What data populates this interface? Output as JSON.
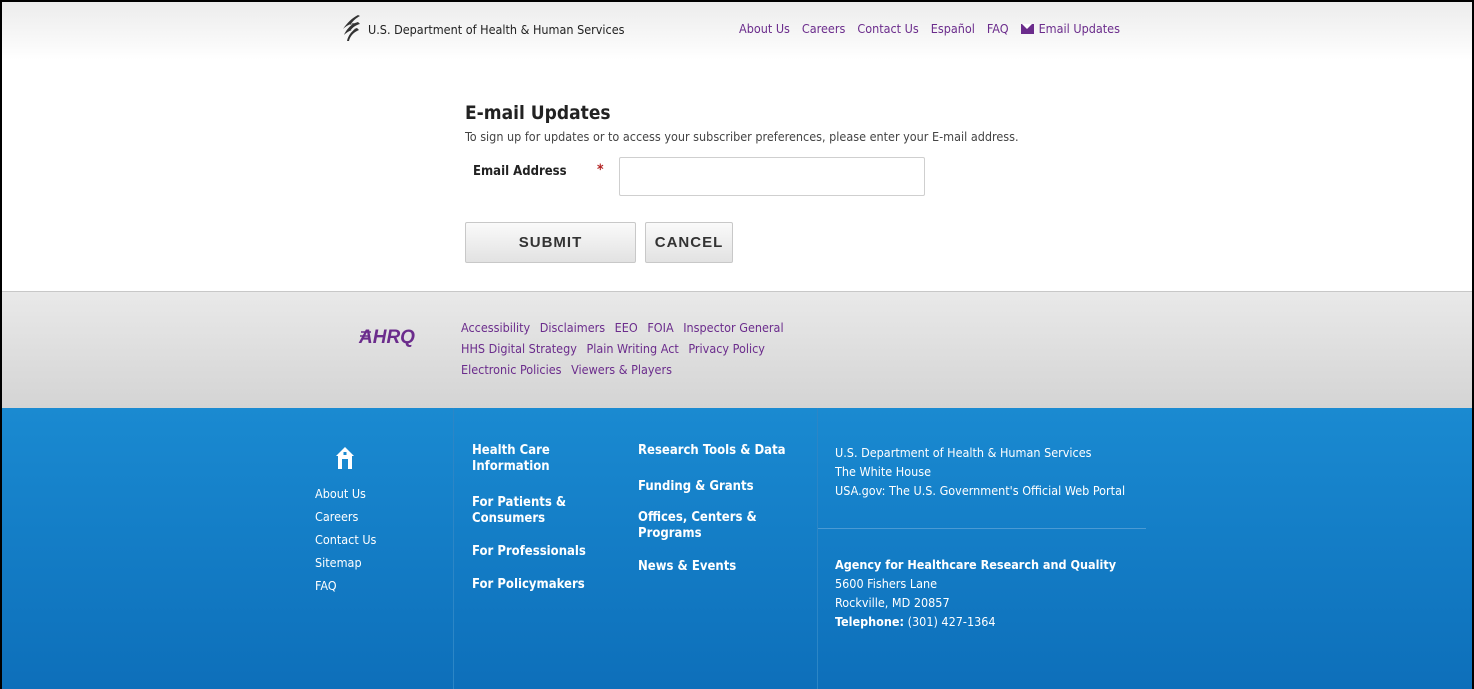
{
  "header": {
    "agency": "U.S. Department of Health & Human Services",
    "nav": [
      "About Us",
      "Careers",
      "Contact Us",
      "Español",
      "FAQ"
    ],
    "email_updates": "Email Updates"
  },
  "form": {
    "title": "E-mail Updates",
    "description": "To sign up for updates or to access your subscriber preferences, please enter your E-mail address.",
    "email_label": "Email Address",
    "required_marker": "*",
    "email_value": "",
    "submit_label": "SUBMIT",
    "cancel_label": "CANCEL"
  },
  "policy": {
    "logo_text": "AHRQ",
    "links": [
      [
        "Accessibility",
        "Disclaimers",
        "EEO",
        "FOIA",
        "Inspector General"
      ],
      [
        "HHS Digital Strategy",
        "Plain Writing Act",
        "Privacy Policy"
      ],
      [
        "Electronic Policies",
        "Viewers & Players"
      ]
    ]
  },
  "footer": {
    "col1": [
      "About Us",
      "Careers",
      "Contact Us",
      "Sitemap",
      "FAQ"
    ],
    "col2": [
      "Health Care Information",
      "For Patients & Consumers",
      "For Professionals",
      "For Policymakers"
    ],
    "col3": [
      "Research Tools & Data",
      "Funding & Grants",
      "Offices, Centers & Programs",
      "News & Events"
    ],
    "col4": [
      "U.S. Department of Health & Human Services",
      "The White House",
      "USA.gov: The U.S. Government's Official Web Portal"
    ],
    "address": {
      "org": "Agency for Healthcare Research and Quality",
      "street": "5600 Fishers Lane",
      "city": "Rockville, MD 20857",
      "phone_label": "Telephone:",
      "phone": "(301) 427-1364"
    }
  },
  "colors": {
    "link_purple": "#6b2c8c",
    "footer_blue": "#1a8ad1",
    "required_red": "#b22222"
  }
}
